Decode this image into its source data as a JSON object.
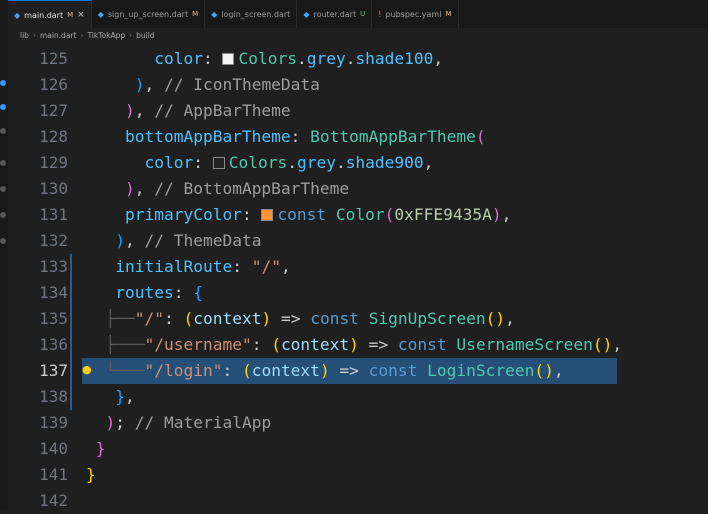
{
  "tabs": [
    {
      "label": "main.dart",
      "badge": "M",
      "active": true
    },
    {
      "label": "sign_up_screen.dart",
      "badge": "M",
      "active": false
    },
    {
      "label": "login_screen.dart",
      "badge": "",
      "active": false
    },
    {
      "label": "router.dart",
      "badge": "U",
      "active": false
    },
    {
      "label": "pubspec.yaml",
      "badge": "M",
      "active": false
    }
  ],
  "breadcrumbs": [
    "lib",
    "main.dart",
    "TikTokApp",
    "build"
  ],
  "current_line": 137,
  "lines": [
    {
      "num": "125",
      "indent": "       ",
      "parts": [
        [
          "k",
          "color"
        ],
        [
          "p",
          ": "
        ],
        [
          "sw",
          "#f5f5f5"
        ],
        [
          "c",
          "Colors"
        ],
        [
          "p",
          "."
        ],
        [
          "k",
          "grey"
        ],
        [
          "p",
          "."
        ],
        [
          "k",
          "shade100"
        ],
        [
          "p",
          ","
        ]
      ]
    },
    {
      "num": "126",
      "indent": "     ",
      "parts": [
        [
          "b3",
          ")"
        ],
        [
          "p",
          ", "
        ],
        [
          "cm",
          "// IconThemeData"
        ]
      ]
    },
    {
      "num": "127",
      "indent": "    ",
      "parts": [
        [
          "b2",
          ")"
        ],
        [
          "p",
          ", "
        ],
        [
          "cm",
          "// AppBarTheme"
        ]
      ]
    },
    {
      "num": "128",
      "indent": "    ",
      "parts": [
        [
          "k",
          "bottomAppBarTheme"
        ],
        [
          "p",
          ": "
        ],
        [
          "c",
          "BottomAppBarTheme"
        ],
        [
          "b2",
          "("
        ]
      ]
    },
    {
      "num": "129",
      "indent": "      ",
      "parts": [
        [
          "k",
          "color"
        ],
        [
          "p",
          ": "
        ],
        [
          "sw",
          "#212121"
        ],
        [
          "c",
          "Colors"
        ],
        [
          "p",
          "."
        ],
        [
          "k",
          "grey"
        ],
        [
          "p",
          "."
        ],
        [
          "k",
          "shade900"
        ],
        [
          "p",
          ","
        ]
      ]
    },
    {
      "num": "130",
      "indent": "    ",
      "parts": [
        [
          "b2",
          ")"
        ],
        [
          "p",
          ", "
        ],
        [
          "cm",
          "// BottomAppBarTheme"
        ]
      ]
    },
    {
      "num": "131",
      "indent": "    ",
      "parts": [
        [
          "k",
          "primaryColor"
        ],
        [
          "p",
          ": "
        ],
        [
          "sw",
          "#fe9435"
        ],
        [
          "kw",
          "const "
        ],
        [
          "c",
          "Color"
        ],
        [
          "b2",
          "("
        ],
        [
          "n",
          "0xFFE9435A"
        ],
        [
          "b2",
          ")"
        ],
        [
          "p",
          ","
        ]
      ]
    },
    {
      "num": "132",
      "indent": "   ",
      "parts": [
        [
          "b3",
          ")"
        ],
        [
          "p",
          ", "
        ],
        [
          "cm",
          "// ThemeData"
        ]
      ]
    },
    {
      "num": "133",
      "indent": "   ",
      "parts": [
        [
          "k",
          "initialRoute"
        ],
        [
          "p",
          ": "
        ],
        [
          "s",
          "\"/\""
        ],
        [
          "p",
          ","
        ]
      ]
    },
    {
      "num": "134",
      "indent": "   ",
      "parts": [
        [
          "k",
          "routes"
        ],
        [
          "p",
          ": "
        ],
        [
          "b3",
          "{"
        ]
      ]
    },
    {
      "num": "135",
      "indent": "  ├──",
      "parts": [
        [
          "s",
          "\"/\""
        ],
        [
          "p",
          ": "
        ],
        [
          "b1",
          "("
        ],
        [
          "v",
          "context"
        ],
        [
          "b1",
          ")"
        ],
        [
          "p",
          " => "
        ],
        [
          "kw",
          "const "
        ],
        [
          "c",
          "SignUpScreen"
        ],
        [
          "b1",
          "()"
        ],
        [
          "p",
          ","
        ]
      ]
    },
    {
      "num": "136",
      "indent": "  ├───",
      "parts": [
        [
          "s",
          "\"/username\""
        ],
        [
          "p",
          ": "
        ],
        [
          "b1",
          "("
        ],
        [
          "v",
          "context"
        ],
        [
          "b1",
          ")"
        ],
        [
          "p",
          " => "
        ],
        [
          "kw",
          "const "
        ],
        [
          "c",
          "UsernameScreen"
        ],
        [
          "b1",
          "()"
        ],
        [
          "p",
          ","
        ]
      ]
    },
    {
      "num": "137",
      "indent": "  └───",
      "parts": [
        [
          "s",
          "\"/login\""
        ],
        [
          "p",
          ": "
        ],
        [
          "b1",
          "("
        ],
        [
          "v",
          "context"
        ],
        [
          "b1",
          ")"
        ],
        [
          "p",
          " => "
        ],
        [
          "kw",
          "const "
        ],
        [
          "c",
          "LoginScreen"
        ],
        [
          "b1",
          "()"
        ],
        [
          "p",
          ","
        ]
      ]
    },
    {
      "num": "138",
      "indent": "   ",
      "parts": [
        [
          "b3",
          "}"
        ],
        [
          "p",
          ","
        ]
      ]
    },
    {
      "num": "139",
      "indent": "  ",
      "parts": [
        [
          "b2",
          ")"
        ],
        [
          "p",
          "; "
        ],
        [
          "cm",
          "// MaterialApp"
        ]
      ]
    },
    {
      "num": "140",
      "indent": " ",
      "parts": [
        [
          "b2",
          "}"
        ]
      ]
    },
    {
      "num": "141",
      "indent": "",
      "parts": [
        [
          "b1",
          "}"
        ]
      ]
    },
    {
      "num": "142",
      "indent": "",
      "parts": []
    }
  ]
}
